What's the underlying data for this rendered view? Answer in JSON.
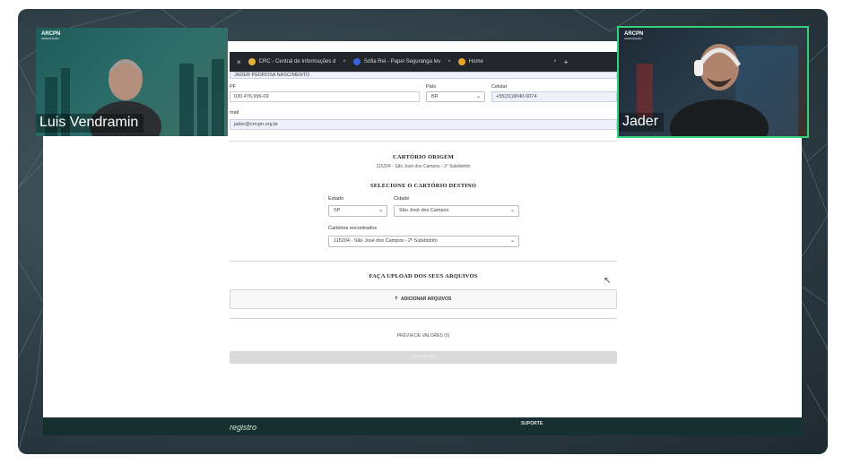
{
  "browser": {
    "tabs": [
      {
        "label": "CRC - Central de Informações d",
        "fav_color": "#e6b03a"
      },
      {
        "label": "Sofia Rei - Papel Seguranga lev",
        "fav_color": "#3a5fd8"
      },
      {
        "label": "Home",
        "fav_color": "#e4a52a"
      }
    ],
    "tab_close": "×",
    "new_tab": "+"
  },
  "form": {
    "name_value": "JADER PEDROSA NASCIMENTO",
    "cpf_label": "PF",
    "cpf_value": "030.476.996-09",
    "pais_label": "País",
    "pais_value": "BR",
    "celular_label": "Celular",
    "celular_value": "+55(31)9040-0074",
    "email_label": "mail",
    "email_value": "jader@crrcpn.org.br",
    "origem_title": "CARTÓRIO ORIGEM",
    "origem_value": "115204 - São José dos Campos - 2º Subdistrito",
    "destino_title": "SELECIONE O CARTÓRIO DESTINO",
    "estado_label": "Estado",
    "estado_value": "SP",
    "cidade_label": "Cidade",
    "cidade_value": "São José dos Campos",
    "encontrados_label": "Cartórios encontrados",
    "encontrados_value": "115204 - São José dos Campos - 2º Subdistrito",
    "upload_title": "FAÇA UPLOAD DOS SEUS ARQUIVOS",
    "upload_button": "ADICIONAR ARQUIVOS",
    "preview_label": "PRÉVIA DE VALORES (0)",
    "submit_label": "CONTINUAR"
  },
  "footer": {
    "logo": "registro",
    "suporte": "SUPORTE"
  },
  "participants": [
    {
      "name": "Luis Vendramin",
      "brand": "ARCPN",
      "brand_sub": "ASSOCIAÇÃO"
    },
    {
      "name": "Jader",
      "brand": "ARCPN",
      "brand_sub": "ASSOCIAÇÃO"
    }
  ],
  "colors": {
    "active_speaker_outline": "#37d07a",
    "footer_bg": "#15302e"
  }
}
